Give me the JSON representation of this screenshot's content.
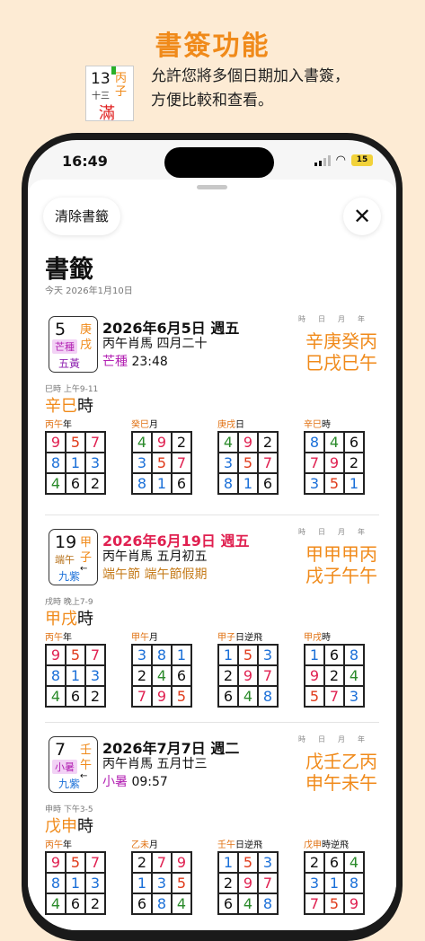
{
  "promo": {
    "title": "書簽功能",
    "icon": {
      "num": "13",
      "gz1": "丙",
      "gz2": "子",
      "lunar": "十三",
      "big": "滿"
    },
    "desc_line1": "允許您將多個日期加入書簽，",
    "desc_line2": "方便比較和查看。"
  },
  "status": {
    "time": "16:49",
    "battery": "15"
  },
  "sheet": {
    "clear_label": "清除書籤",
    "close_symbol": "✕",
    "title": "書籤",
    "today": "今天 2026年1月10日"
  },
  "pillar_labels": "時日月年",
  "entries": [
    {
      "card": {
        "num": "5",
        "gz1": "庚",
        "gz2": "戌",
        "term": "芒種",
        "star": "五黃",
        "arrow": ""
      },
      "line1": "2026年6月5日 週五",
      "line2": "丙午肖馬 四月二十",
      "line3_term": "芒種",
      "line3_rest": " 23:48",
      "pillars_top": "辛庚癸丙",
      "pillars_bot": "巳戌巳午",
      "hour_small": "巳時 上午9-11",
      "hour_gz": "辛巳",
      "hour_suffix": "時",
      "grids": [
        {
          "gz": "丙午",
          "label": "年",
          "cells": [
            "9",
            "5",
            "7",
            "8",
            "1",
            "3",
            "4",
            "6",
            "2"
          ]
        },
        {
          "gz": "癸巳",
          "label": "月",
          "cells": [
            "4",
            "9",
            "2",
            "3",
            "5",
            "7",
            "8",
            "1",
            "6"
          ]
        },
        {
          "gz": "庚戌",
          "label": "日",
          "cells": [
            "4",
            "9",
            "2",
            "3",
            "5",
            "7",
            "8",
            "1",
            "6"
          ]
        },
        {
          "gz": "辛巳",
          "label": "時",
          "cells": [
            "8",
            "4",
            "6",
            "7",
            "9",
            "2",
            "3",
            "5",
            "1"
          ]
        }
      ]
    },
    {
      "card": {
        "num": "19",
        "gz1": "甲",
        "gz2": "子",
        "term": "端午",
        "star": "九紫",
        "arrow": "←"
      },
      "line1": "2026年6月19日 週五",
      "line2": "丙午肖馬 五月初五",
      "line3_term": "端午節 端午節假期",
      "line3_rest": "",
      "pillars_top": "甲甲甲丙",
      "pillars_bot": "戌子午午",
      "hour_small": "戌時 晚上7-9",
      "hour_gz": "甲戌",
      "hour_suffix": "時",
      "grids": [
        {
          "gz": "丙午",
          "label": "年",
          "cells": [
            "9",
            "5",
            "7",
            "8",
            "1",
            "3",
            "4",
            "6",
            "2"
          ]
        },
        {
          "gz": "甲午",
          "label": "月",
          "cells": [
            "3",
            "8",
            "1",
            "2",
            "4",
            "6",
            "7",
            "9",
            "5"
          ]
        },
        {
          "gz": "甲子",
          "label": "日逆飛",
          "cells": [
            "1",
            "5",
            "3",
            "2",
            "9",
            "7",
            "6",
            "4",
            "8"
          ]
        },
        {
          "gz": "甲戌",
          "label": "時",
          "cells": [
            "1",
            "6",
            "8",
            "9",
            "2",
            "4",
            "5",
            "7",
            "3"
          ]
        }
      ]
    },
    {
      "card": {
        "num": "7",
        "gz1": "壬",
        "gz2": "午",
        "term": "小暑",
        "star": "九紫",
        "arrow": "←"
      },
      "line1": "2026年7月7日 週二",
      "line2": "丙午肖馬 五月廿三",
      "line3_term": "小暑",
      "line3_rest": " 09:57",
      "pillars_top": "戊壬乙丙",
      "pillars_bot": "申午未午",
      "hour_small": "申時 下午3-5",
      "hour_gz": "戊申",
      "hour_suffix": "時",
      "grids": [
        {
          "gz": "丙午",
          "label": "年",
          "cells": [
            "9",
            "5",
            "7",
            "8",
            "1",
            "3",
            "4",
            "6",
            "2"
          ]
        },
        {
          "gz": "乙未",
          "label": "月",
          "cells": [
            "2",
            "7",
            "9",
            "1",
            "3",
            "5",
            "6",
            "8",
            "4"
          ]
        },
        {
          "gz": "壬午",
          "label": "日逆飛",
          "cells": [
            "1",
            "5",
            "3",
            "2",
            "9",
            "7",
            "6",
            "4",
            "8"
          ]
        },
        {
          "gz": "戊申",
          "label": "時逆飛",
          "cells": [
            "2",
            "6",
            "4",
            "3",
            "1",
            "8",
            "7",
            "5",
            "9"
          ]
        }
      ]
    }
  ]
}
